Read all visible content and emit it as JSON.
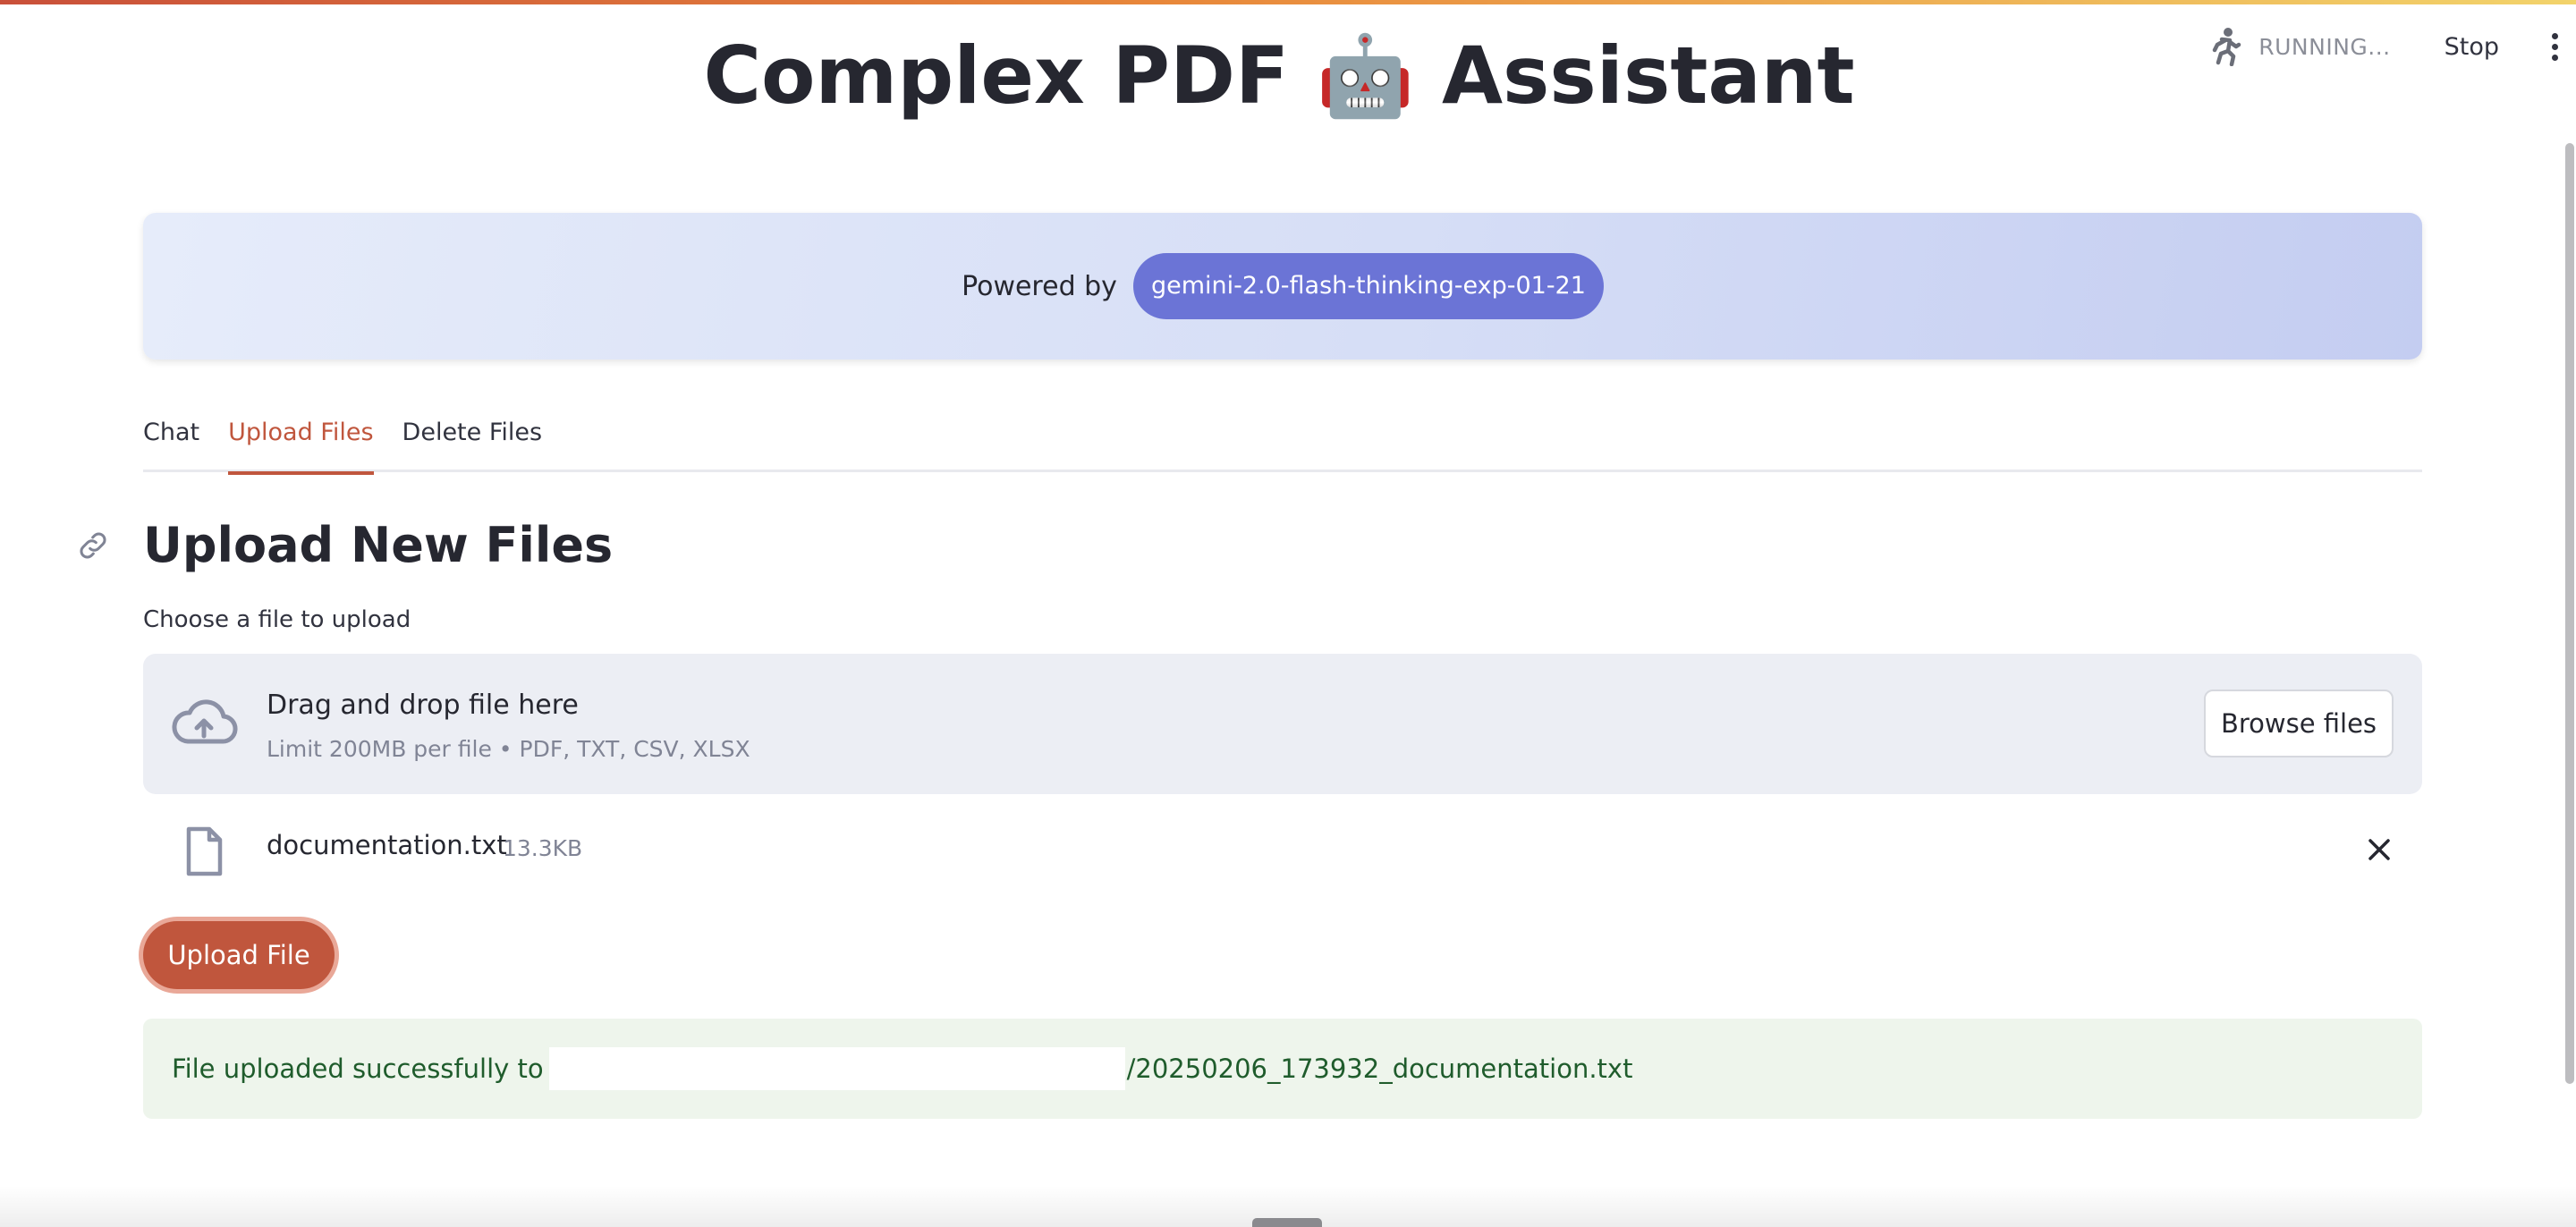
{
  "app": {
    "title": "Complex PDF 🤖 Assistant"
  },
  "toolbar": {
    "status_text": "RUNNING...",
    "stop_label": "Stop",
    "running_icon": "running-man-icon",
    "menu_icon": "vertical-dots-icon"
  },
  "banner": {
    "powered_label": "Powered by",
    "model_name": "gemini-2.0-flash-thinking-exp-01-21"
  },
  "tabs": [
    {
      "label": "Chat",
      "active": false
    },
    {
      "label": "Upload Files",
      "active": true
    },
    {
      "label": "Delete Files",
      "active": false
    }
  ],
  "upload_section": {
    "heading": "Upload New Files",
    "field_label": "Choose a file to upload",
    "dropzone_title": "Drag and drop file here",
    "dropzone_hint": "Limit 200MB per file • PDF, TXT, CSV, XLSX",
    "browse_label": "Browse files",
    "file": {
      "name": "documentation.txt",
      "size": "13.3KB"
    },
    "submit_label": "Upload File"
  },
  "status": {
    "prefix": "File uploaded successfully to",
    "suffix": "/20250206_173932_documentation.txt"
  },
  "colors": {
    "accent": "#c0563d",
    "model_pill": "#6b74d6",
    "success_bg": "#eef5ec",
    "success_text": "#1f5c2c"
  }
}
